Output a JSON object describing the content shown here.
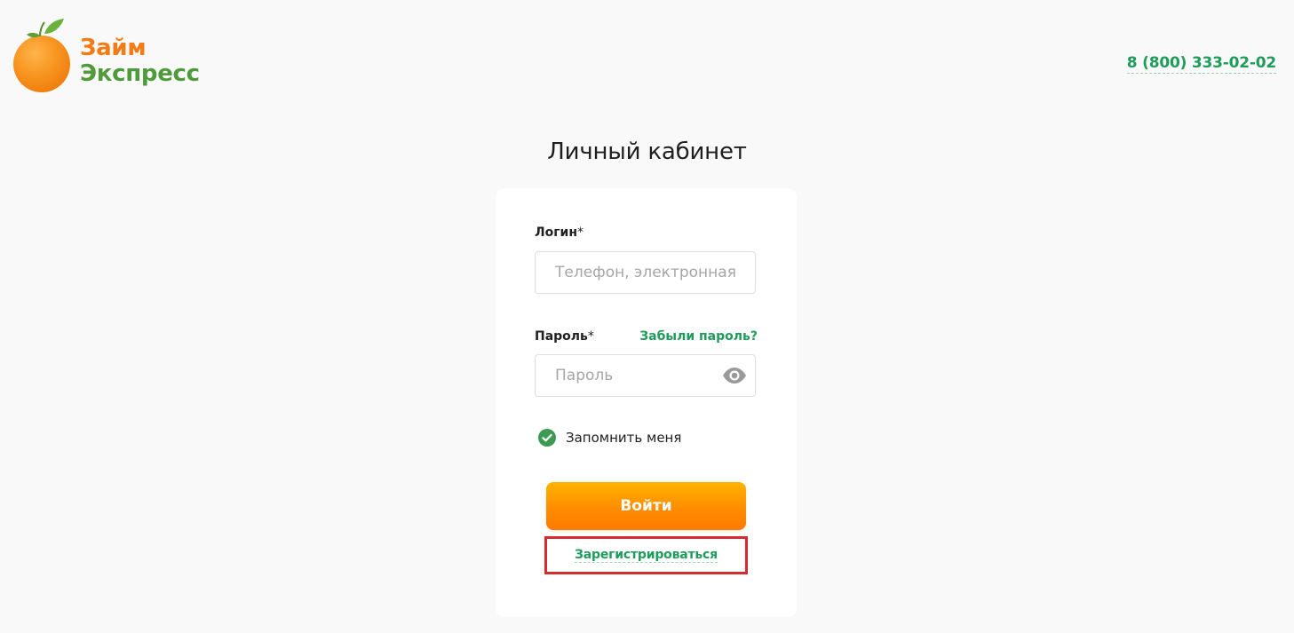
{
  "header": {
    "logo": {
      "line1": "Займ",
      "line2": "Экспресс",
      "icon": "orange-icon"
    },
    "phone": "8 (800) 333-02-02"
  },
  "page_title": "Личный кабинет",
  "form": {
    "login": {
      "label": "Логин",
      "required_mark": "*",
      "placeholder": "Телефон, электронная почта",
      "value": ""
    },
    "password": {
      "label": "Пароль",
      "required_mark": "*",
      "placeholder": "Пароль",
      "value": "",
      "toggle_icon": "eye-icon"
    },
    "forgot_password": "Забыли пароль?",
    "remember_me": {
      "label": "Запомнить меня",
      "checked": true,
      "icon": "checkmark-circle-icon"
    },
    "submit_label": "Войти",
    "register_label": "Зарегистрироваться"
  },
  "colors": {
    "background": "#f9f9f9",
    "brand_orange": "#f47c16",
    "brand_green": "#4f9a3b",
    "link_green": "#1f9c5b",
    "button_gradient_top": "#ffb400",
    "button_gradient_bottom": "#ff7a00",
    "highlight_red": "#d52c31"
  }
}
